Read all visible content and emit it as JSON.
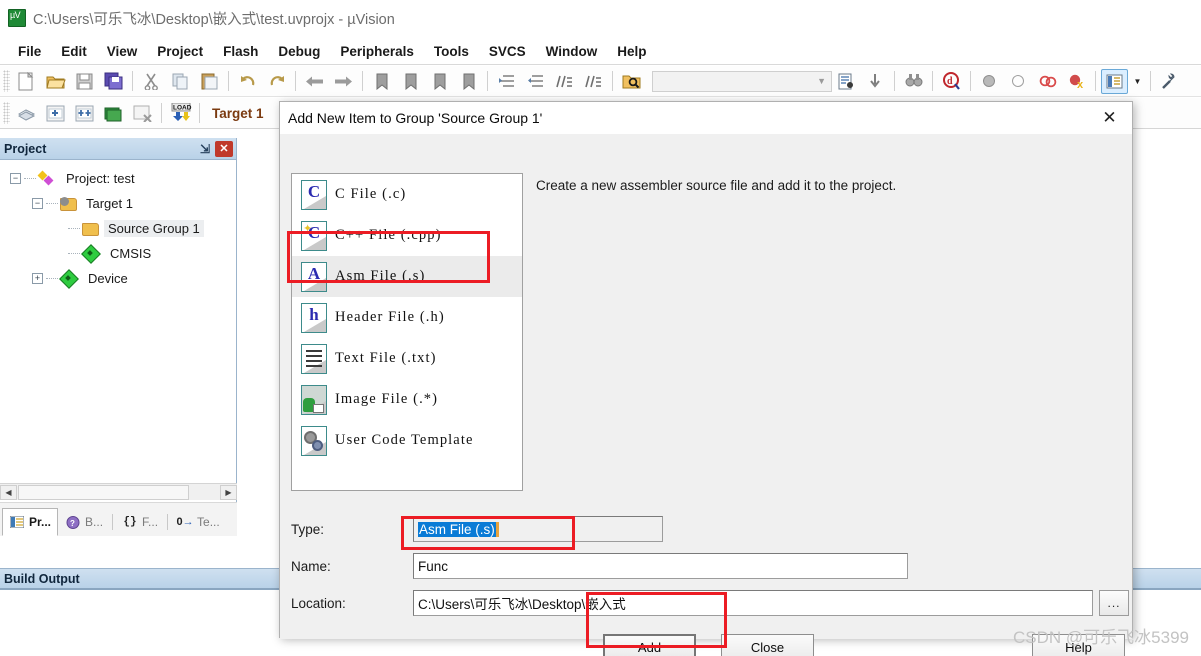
{
  "window": {
    "title": "C:\\Users\\可乐飞冰\\Desktop\\嵌入式\\test.uvprojx - µVision",
    "app_icon": "uvision-icon"
  },
  "menubar": {
    "items": [
      {
        "label": "File"
      },
      {
        "label": "Edit"
      },
      {
        "label": "View"
      },
      {
        "label": "Project"
      },
      {
        "label": "Flash"
      },
      {
        "label": "Debug"
      },
      {
        "label": "Peripherals"
      },
      {
        "label": "Tools"
      },
      {
        "label": "SVCS"
      },
      {
        "label": "Window"
      },
      {
        "label": "Help"
      }
    ]
  },
  "toolbar_row1": {
    "buttons": [
      {
        "name": "new-file-icon",
        "glyph": "🗋"
      },
      {
        "name": "open-file-icon",
        "glyph": "📂"
      },
      {
        "name": "save-icon",
        "glyph": "💾"
      },
      {
        "name": "save-all-icon",
        "glyph": "🖫"
      },
      {
        "name": "cut-icon",
        "glyph": "✂"
      },
      {
        "name": "copy-icon",
        "glyph": "⧉"
      },
      {
        "name": "paste-icon",
        "glyph": "📋"
      },
      {
        "name": "undo-icon",
        "glyph": "↶"
      },
      {
        "name": "redo-icon",
        "glyph": "↷"
      },
      {
        "name": "navigate-back-icon",
        "glyph": "⬅"
      },
      {
        "name": "navigate-forward-icon",
        "glyph": "➡"
      },
      {
        "name": "bookmark-toggle-icon",
        "glyph": "🔖"
      },
      {
        "name": "bookmark-prev-icon",
        "glyph": "🔖"
      },
      {
        "name": "bookmark-next-icon",
        "glyph": "🔖"
      },
      {
        "name": "bookmark-clear-icon",
        "glyph": "🔖"
      },
      {
        "name": "indent-icon",
        "glyph": "⇥"
      },
      {
        "name": "outdent-icon",
        "glyph": "⇤"
      },
      {
        "name": "comment-icon",
        "glyph": "//"
      },
      {
        "name": "uncomment-icon",
        "glyph": "//"
      },
      {
        "name": "find-in-files-icon",
        "glyph": "🔍"
      }
    ],
    "search_combo_value": "",
    "after_combo": [
      {
        "name": "file-search-icon",
        "glyph": "📄"
      },
      {
        "name": "bookmark-jump-icon",
        "glyph": "⬇"
      },
      {
        "name": "binoculars-icon",
        "glyph": "🔭"
      },
      {
        "name": "debug-session-icon",
        "glyph": "⊘"
      },
      {
        "name": "breakpoint-insert-icon",
        "glyph": "⬤"
      },
      {
        "name": "breakpoint-remove-icon",
        "glyph": "◯"
      },
      {
        "name": "breakpoint-disable-icon",
        "glyph": "⊙"
      },
      {
        "name": "breakpoint-kill-icon",
        "glyph": "⊗"
      },
      {
        "name": "window-manager-icon",
        "glyph": "▤"
      },
      {
        "name": "configure-icon",
        "glyph": "🔧"
      }
    ]
  },
  "toolbar_row2": {
    "buttons": [
      {
        "name": "translate-icon",
        "glyph": "◈"
      },
      {
        "name": "build-icon",
        "glyph": "▦"
      },
      {
        "name": "rebuild-icon",
        "glyph": "▦"
      },
      {
        "name": "batch-build-icon",
        "glyph": "▤"
      },
      {
        "name": "stop-build-icon",
        "glyph": "▦"
      },
      {
        "name": "download-icon",
        "glyph": "LOAD"
      }
    ],
    "target_selector": "Target 1"
  },
  "project_panel": {
    "title": "Project",
    "pin_icon": "pin-icon",
    "close_icon": "close-icon",
    "tree": [
      {
        "label": "Project: test",
        "icon": "project-icon",
        "expander": "minus",
        "depth": 0,
        "selected": false
      },
      {
        "label": "Target 1",
        "icon": "target-folder-icon",
        "expander": "minus",
        "depth": 1,
        "selected": false
      },
      {
        "label": "Source Group 1",
        "icon": "folder-icon",
        "expander": "none",
        "depth": 2,
        "selected": true
      },
      {
        "label": "CMSIS",
        "icon": "component-icon",
        "expander": "none",
        "depth": 2,
        "selected": false
      },
      {
        "label": "Device",
        "icon": "component-icon",
        "expander": "plus",
        "depth": 2,
        "selected": false
      }
    ],
    "tabs": [
      {
        "label": "Pr...",
        "icon": "project-tab-icon",
        "active": true
      },
      {
        "label": "B...",
        "icon": "books-tab-icon",
        "active": false
      },
      {
        "label": "F...",
        "icon": "functions-tab-icon",
        "active": false
      },
      {
        "label": "Te...",
        "icon": "templates-tab-icon",
        "active": false
      }
    ]
  },
  "build_output": {
    "title": "Build Output",
    "content": ""
  },
  "dialog": {
    "title": "Add New Item to Group 'Source Group 1'",
    "close_icon": "close-icon",
    "description": "Create a new assembler source file and add it to the project.",
    "file_types": [
      {
        "label": "C File (.c)",
        "icon": "c-file-icon",
        "glyph": "C",
        "selected": false
      },
      {
        "label": "C++ File (.cpp)",
        "icon": "cpp-file-icon",
        "glyph": "C",
        "selected": false
      },
      {
        "label": "Asm File (.s)",
        "icon": "asm-file-icon",
        "glyph": "A",
        "selected": true
      },
      {
        "label": "Header File (.h)",
        "icon": "header-file-icon",
        "glyph": "h",
        "selected": false
      },
      {
        "label": "Text File (.txt)",
        "icon": "text-file-icon",
        "glyph": "",
        "selected": false
      },
      {
        "label": "Image File (.*)",
        "icon": "image-file-icon",
        "glyph": "",
        "selected": false
      },
      {
        "label": "User Code Template",
        "icon": "template-file-icon",
        "glyph": "",
        "selected": false
      }
    ],
    "fields": {
      "type_label": "Type:",
      "type_value": "Asm File (.s)",
      "name_label": "Name:",
      "name_value": "Func",
      "location_label": "Location:",
      "location_value": "C:\\Users\\可乐飞冰\\Desktop\\嵌入式",
      "browse_label": "..."
    },
    "buttons": {
      "add": "Add",
      "close": "Close",
      "help": "Help"
    }
  },
  "watermark": "CSDN @可乐飞冰5399",
  "colors": {
    "highlight_red": "#ec1c24",
    "selection_blue": "#0a7bd6",
    "panel_header": "#b9d2e8",
    "target_text": "#7b3a10"
  }
}
